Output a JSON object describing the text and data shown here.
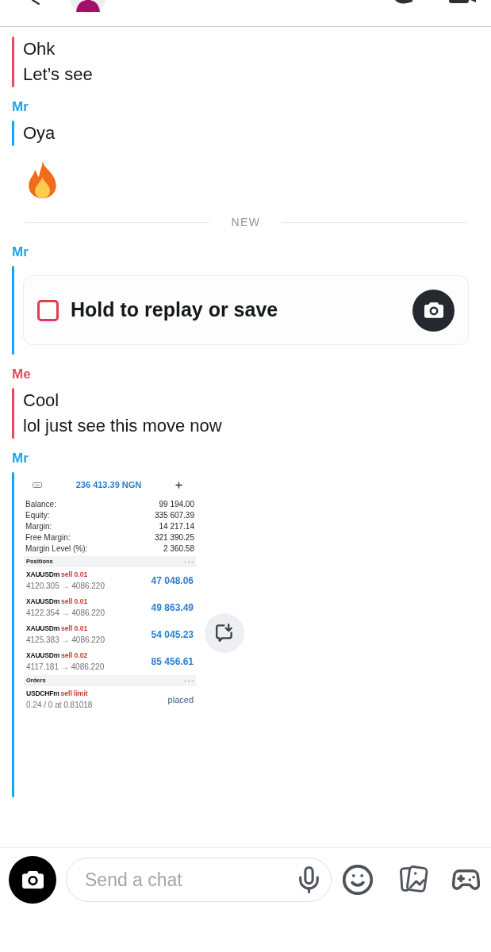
{
  "chat": [
    {
      "kind": "group",
      "color": "#e84a5f",
      "blocks": [
        {
          "kind": "lines",
          "lines": [
            "Ohk",
            "Let’s see"
          ]
        }
      ]
    },
    {
      "kind": "group",
      "sender": "Mr",
      "color": "#14a7f0",
      "blocks": [
        {
          "kind": "lines",
          "lines": [
            "Oya"
          ]
        },
        {
          "kind": "emoji"
        }
      ]
    },
    {
      "kind": "divider",
      "label": "NEW"
    },
    {
      "kind": "group",
      "sender": "Mr",
      "color": "#14a7f0",
      "blocks": [
        {
          "kind": "snap",
          "text": "Hold to replay or save",
          "opened": true
        }
      ]
    },
    {
      "kind": "group",
      "sender": "Me",
      "color": "#e84a5f",
      "blocks": [
        {
          "kind": "lines",
          "lines": [
            "Cool",
            "lol just see this move now"
          ]
        }
      ]
    },
    {
      "kind": "group",
      "sender": "Mr",
      "color": "#14a7f0",
      "blocks": [
        {
          "kind": "screenshot",
          "balance_header": "236 413.39 NGN",
          "summary": [
            {
              "label": "Balance:",
              "value": "99 194.00"
            },
            {
              "label": "Equity:",
              "value": "335 607.39"
            },
            {
              "label": "Margin:",
              "value": "14 217.14"
            },
            {
              "label": "Free Margin:",
              "value": "321 390.25"
            },
            {
              "label": "Margin Level (%):",
              "value": "2 360.58"
            }
          ],
          "sections": [
            {
              "title": "Positions",
              "rows": [
                {
                  "kind": "position",
                  "symbol": "XAUUSDm",
                  "order": "sell 0.01",
                  "detail": "4120.305 → 4086.220",
                  "value": "47 048.06"
                },
                {
                  "kind": "position",
                  "symbol": "XAUUSDm",
                  "order": "sell 0.01",
                  "detail": "4122.354 → 4086.220",
                  "value": "49 863.49"
                },
                {
                  "kind": "position",
                  "symbol": "XAUUSDm",
                  "order": "sell 0.01",
                  "detail": "4125.383 → 4086.220",
                  "value": "54 045.23"
                },
                {
                  "kind": "position",
                  "symbol": "XAUUSDm",
                  "order": "sell 0.02",
                  "detail": "4117.181 → 4086.220",
                  "value": "85 456.61"
                }
              ]
            },
            {
              "title": "Orders",
              "rows": [
                {
                  "kind": "order",
                  "symbol": "USDCHFm",
                  "order": "sell limit",
                  "detail": "0.24 / 0 at 0.81018",
                  "value": "placed"
                }
              ]
            }
          ]
        }
      ]
    }
  ],
  "composer": {
    "placeholder": "Send a chat"
  }
}
